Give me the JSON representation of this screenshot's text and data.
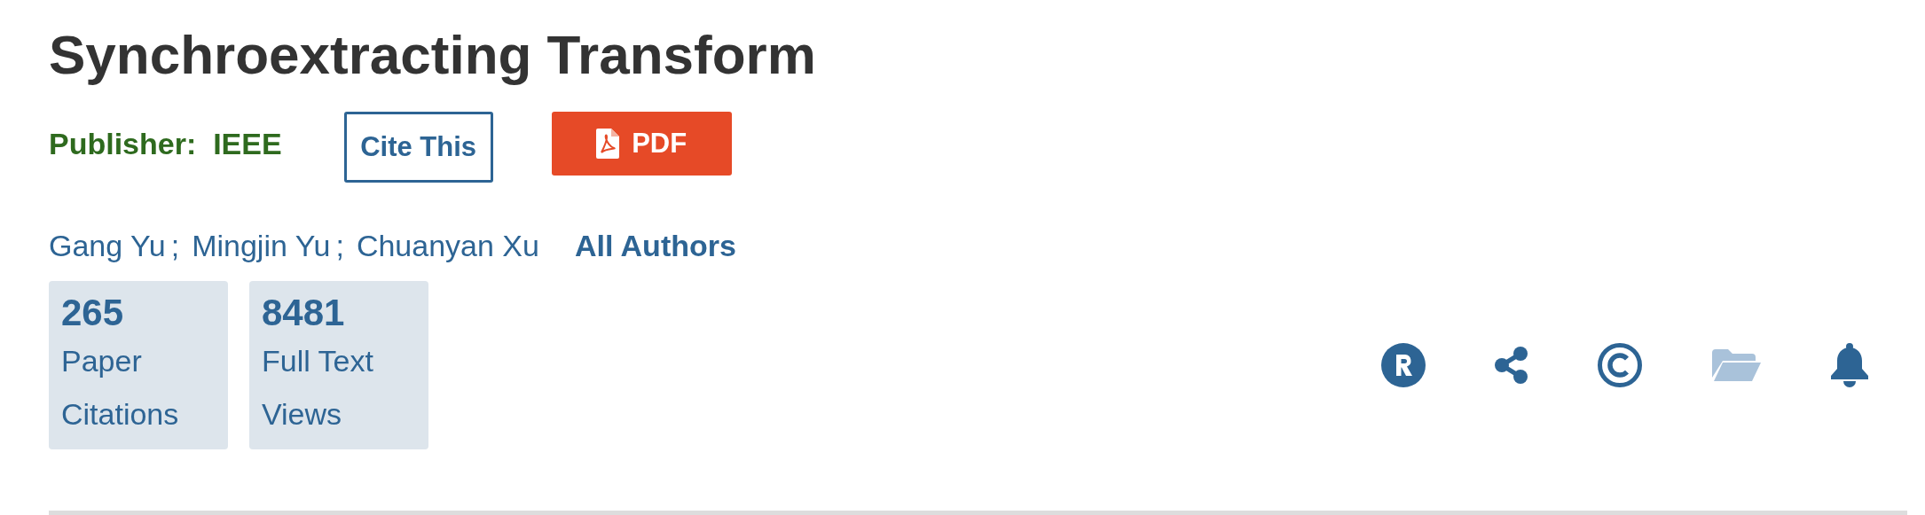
{
  "title": "Synchroextracting Transform",
  "publisher": {
    "label": "Publisher:",
    "name": "IEEE"
  },
  "buttons": {
    "cite": "Cite This",
    "pdf": "PDF"
  },
  "authors": [
    "Gang Yu",
    "Mingjin Yu",
    "Chuanyan Xu"
  ],
  "author_separator": ";",
  "all_authors": "All Authors",
  "metrics": [
    {
      "value": "265",
      "label": "Paper Citations"
    },
    {
      "value": "8481",
      "label": "Full Text Views"
    }
  ],
  "actions": [
    {
      "kind": "rights",
      "disabled": false
    },
    {
      "kind": "share",
      "disabled": false
    },
    {
      "kind": "copyright",
      "disabled": false
    },
    {
      "kind": "folder",
      "disabled": true
    },
    {
      "kind": "alert",
      "disabled": false
    }
  ]
}
